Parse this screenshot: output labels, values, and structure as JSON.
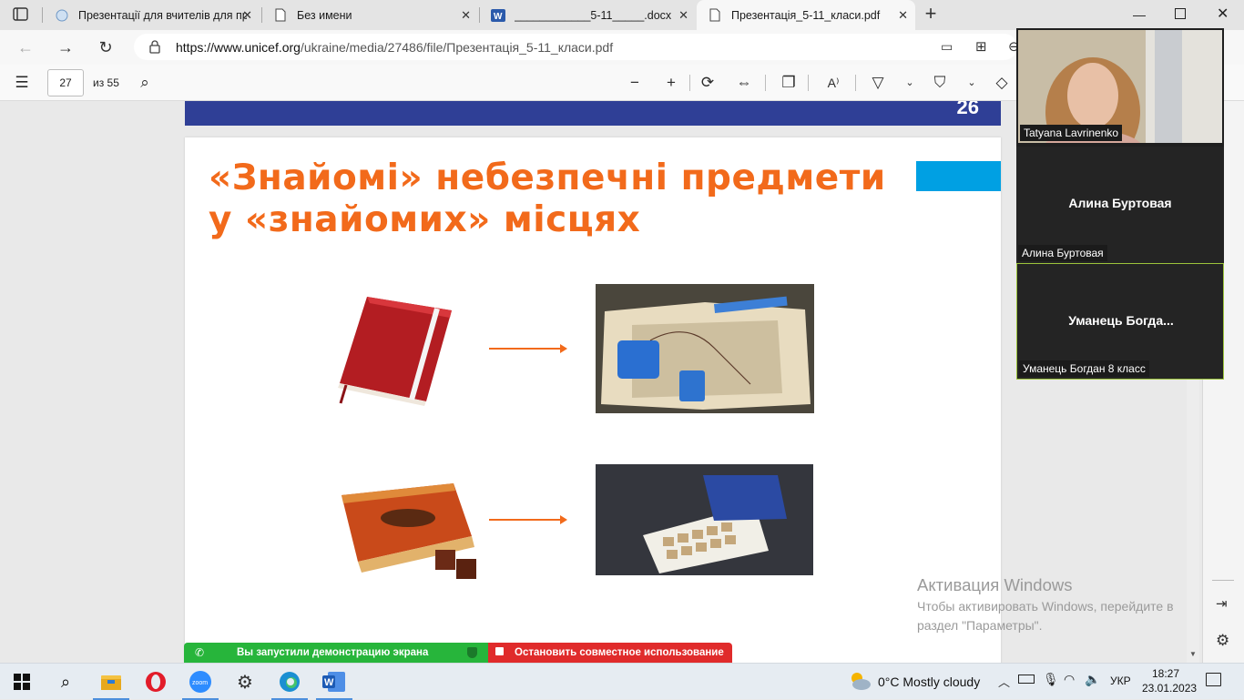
{
  "browser": {
    "tabs": [
      {
        "label": "Презентації для вчителів для пр",
        "icon": "globe-icon"
      },
      {
        "label": "Без имени",
        "icon": "document-icon"
      },
      {
        "label": "____________5-11_____.docx",
        "icon": "word-icon"
      },
      {
        "label": "Презентація_5-11_класи.pdf",
        "icon": "document-icon",
        "active": true
      }
    ],
    "url_host": "https://www.unicef.org",
    "url_path": "/ukraine/media/27486/file/Презентація_5-11_класи.pdf"
  },
  "pdf_toolbar": {
    "page_number": "27",
    "page_total": "из 55"
  },
  "document": {
    "previous_page_number": "26",
    "slide_title_line1": "«Знайомі» небезпечні предмети",
    "slide_title_line2": "у «знайомих» місцях",
    "colors": {
      "accent_orange": "#f26a1b",
      "header_blue": "#2f3f96",
      "cyan": "#00a0e3"
    }
  },
  "video": {
    "participants": [
      {
        "label": "Tatyana Lavrinenko",
        "has_video": true
      },
      {
        "display_name": "Алина Буртовая",
        "label": "Алина Буртовая",
        "has_video": false
      },
      {
        "display_name": "Уманець  Богда...",
        "label": "Уманець Богдан 8 класс",
        "has_video": false,
        "active_speaker": true
      }
    ]
  },
  "activation": {
    "title": "Активация Windows",
    "line1": "Чтобы активировать Windows, перейдите в",
    "line2": "раздел \"Параметры\"."
  },
  "share_bar": {
    "status": "Вы запустили демонстрацию экрана",
    "stop": "Остановить совместное использование"
  },
  "taskbar": {
    "weather": "0°C  Mostly cloudy",
    "language": "УКР",
    "time": "18:27",
    "date": "23.01.2023"
  }
}
